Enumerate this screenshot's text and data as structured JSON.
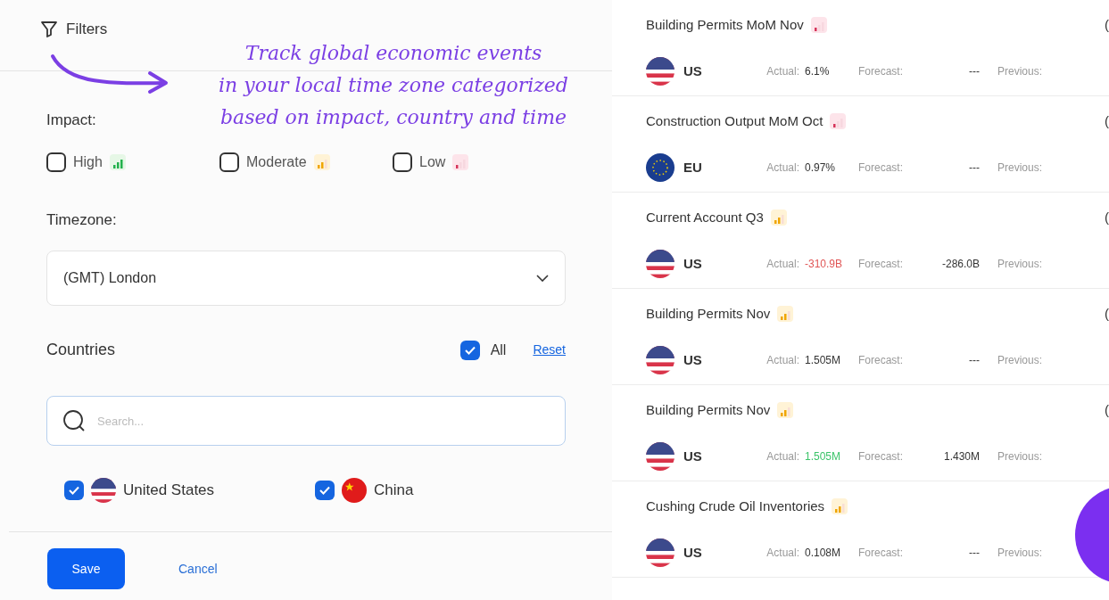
{
  "filters": {
    "title": "Filters"
  },
  "annotation": {
    "lines": [
      "Track global economic events",
      "in your local time zone categorized",
      "based on impact, country and time"
    ]
  },
  "impact": {
    "label": "Impact:",
    "options": [
      {
        "label": "High",
        "icon": {
          "kind": "high"
        },
        "checked": false
      },
      {
        "label": "Moderate",
        "icon": {
          "kind": "moderate"
        },
        "checked": false
      },
      {
        "label": "Low",
        "icon": {
          "kind": "low"
        },
        "checked": false
      }
    ]
  },
  "timezone": {
    "label": "Timezone:",
    "value": "(GMT) London"
  },
  "countries": {
    "label": "Countries",
    "all": {
      "label": "All",
      "checked": true
    },
    "reset": "Reset",
    "search": {
      "placeholder": "Search..."
    },
    "items": [
      {
        "name": "United States",
        "flag": {
          "kind": "us"
        },
        "checked": true
      },
      {
        "name": "China",
        "flag": {
          "kind": "cn"
        },
        "checked": true
      }
    ]
  },
  "footer": {
    "save": "Save",
    "cancel": "Cancel"
  },
  "events": [
    {
      "title": "Building Permits MoM Nov",
      "impact": {
        "kind": "low"
      },
      "flag": {
        "kind": "us"
      },
      "code": "US",
      "actual_label": "Actual:",
      "actual": {
        "text": "6.1%",
        "color": "#333333"
      },
      "forecast_label": "Forecast:",
      "forecast": "---",
      "previous_label": "Previous:",
      "cut": "("
    },
    {
      "title": "Construction Output MoM Oct",
      "impact": {
        "kind": "low"
      },
      "flag": {
        "kind": "eu"
      },
      "code": "EU",
      "actual_label": "Actual:",
      "actual": {
        "text": "0.97%",
        "color": "#333333"
      },
      "forecast_label": "Forecast:",
      "forecast": "---",
      "previous_label": "Previous:",
      "cut": "("
    },
    {
      "title": "Current Account Q3",
      "impact": {
        "kind": "moderate"
      },
      "flag": {
        "kind": "us"
      },
      "code": "US",
      "actual_label": "Actual:",
      "actual": {
        "text": "-310.9B",
        "color": "#e05555"
      },
      "forecast_label": "Forecast:",
      "forecast": "-286.0B",
      "previous_label": "Previous:",
      "cut": "("
    },
    {
      "title": "Building Permits Nov",
      "impact": {
        "kind": "moderate"
      },
      "flag": {
        "kind": "us"
      },
      "code": "US",
      "actual_label": "Actual:",
      "actual": {
        "text": "1.505M",
        "color": "#333333"
      },
      "forecast_label": "Forecast:",
      "forecast": "---",
      "previous_label": "Previous:",
      "cut": "("
    },
    {
      "title": "Building Permits Nov",
      "impact": {
        "kind": "moderate"
      },
      "flag": {
        "kind": "us"
      },
      "code": "US",
      "actual_label": "Actual:",
      "actual": {
        "text": "1.505M",
        "color": "#3cc46a"
      },
      "forecast_label": "Forecast:",
      "forecast": "1.430M",
      "previous_label": "Previous:",
      "cut": "("
    },
    {
      "title": "Cushing Crude Oil Inventories",
      "impact": {
        "kind": "moderate"
      },
      "flag": {
        "kind": "us"
      },
      "code": "US",
      "actual_label": "Actual:",
      "actual": {
        "text": "0.108M",
        "color": "#333333"
      },
      "forecast_label": "Forecast:",
      "forecast": "---",
      "previous_label": "Previous:"
    }
  ]
}
